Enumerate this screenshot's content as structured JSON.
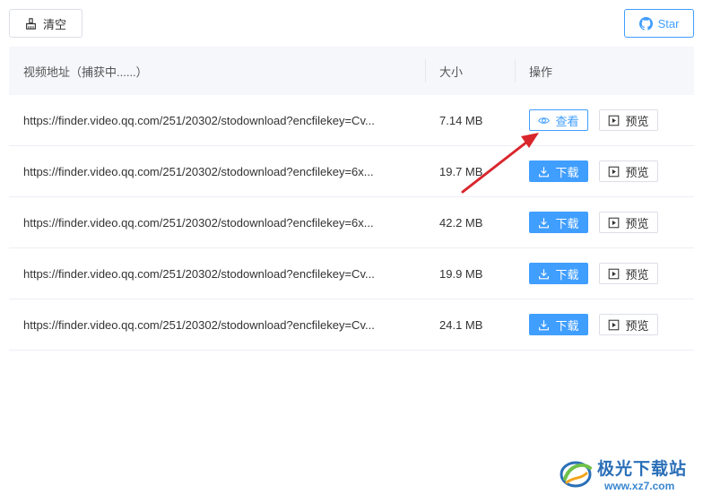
{
  "toolbar": {
    "clear_label": "清空",
    "star_label": "Star"
  },
  "table": {
    "headers": {
      "url": "视频地址（捕获中......）",
      "size": "大小",
      "actions": "操作"
    },
    "rows": [
      {
        "url": "https://finder.video.qq.com/251/20302/stodownload?encfilekey=Cv...",
        "size": "7.14 MB",
        "primary_label": "查看",
        "preview_label": "预览"
      },
      {
        "url": "https://finder.video.qq.com/251/20302/stodownload?encfilekey=6x...",
        "size": "19.7 MB",
        "primary_label": "下载",
        "preview_label": "预览"
      },
      {
        "url": "https://finder.video.qq.com/251/20302/stodownload?encfilekey=6x...",
        "size": "42.2 MB",
        "primary_label": "下载",
        "preview_label": "预览"
      },
      {
        "url": "https://finder.video.qq.com/251/20302/stodownload?encfilekey=Cv...",
        "size": "19.9 MB",
        "primary_label": "下载",
        "preview_label": "预览"
      },
      {
        "url": "https://finder.video.qq.com/251/20302/stodownload?encfilekey=Cv...",
        "size": "24.1 MB",
        "primary_label": "下载",
        "preview_label": "预览"
      }
    ]
  },
  "watermark": {
    "title": "极光下载站",
    "url": "www.xz7.com"
  },
  "colors": {
    "primary": "#409eff",
    "annotation_arrow": "#d9262c"
  },
  "icons": {
    "clear": "broom-icon",
    "star": "github-icon",
    "view": "eye-icon",
    "download": "download-icon",
    "preview": "play-square-icon"
  }
}
